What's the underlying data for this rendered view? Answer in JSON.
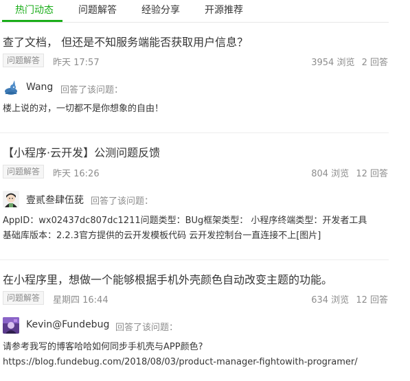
{
  "tabs": [
    {
      "label": "热门动态"
    },
    {
      "label": "问题解答"
    },
    {
      "label": "经验分享"
    },
    {
      "label": "开源推荐"
    }
  ],
  "feed": [
    {
      "title": "查了文档， 但还是不知服务端能否获取用户信息？",
      "tag": "问题解答",
      "time": "昨天 17:57",
      "views": "3954 浏览",
      "answers": "2 回答",
      "author": "Wang",
      "action": "回答了该问题：",
      "avatar_icon": "rabbit-avatar-icon",
      "answer_lines": [
        "楼上说的对，一切都不是你想象的自由！"
      ]
    },
    {
      "title": "【小程序·云开发】公测问题反馈",
      "tag": "问题解答",
      "time": "昨天 16:26",
      "views": "804 浏览",
      "answers": "12 回答",
      "author": "壹贰叁肆伍莸",
      "action": "回答了该问题：",
      "avatar_icon": "cartoon-girl-avatar-icon",
      "answer_lines": [
        "AppID：wx02437dc807dc1211问题类型：BUg框架类型： 小程序终端类型：开发者工具",
        "基础库版本：2.2.3官方提供的云开发模板代码  云开发控制台一直连接不上[图片]"
      ]
    },
    {
      "title": "在小程序里，想做一个能够根据手机外壳颜色自动改变主题的功能。",
      "tag": "问题解答",
      "time": "星期四 16:44",
      "views": "634 浏览",
      "answers": "12 回答",
      "author": "Kevin@Fundebug",
      "action": "回答了该问题：",
      "avatar_icon": "purple-photo-avatar-icon",
      "answer_lines": [
        "请参考我写的博客哈哈如何同步手机壳与APP颜色?",
        "https://blog.fundebug.com/2018/08/03/product-manager-fightowith-programer/"
      ]
    }
  ],
  "colors": {
    "accent": "#1aad19",
    "text": "#353535",
    "muted": "#8d8d8d"
  }
}
